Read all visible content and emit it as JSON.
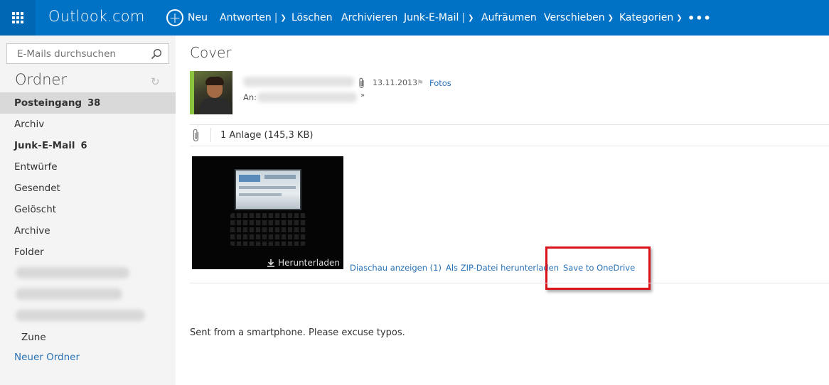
{
  "app": {
    "brand": "Outlook.com"
  },
  "toolbar": {
    "new_label": "Neu",
    "reply_label": "Antworten",
    "delete_label": "Löschen",
    "archive_label": "Archivieren",
    "junk_label": "Junk-E-Mail",
    "sweep_label": "Aufräumen",
    "move_label": "Verschieben",
    "categories_label": "Kategorien",
    "more_label": "•••"
  },
  "sidebar": {
    "search_placeholder": "E-Mails durchsuchen",
    "folders_title": "Ordner",
    "folders": [
      {
        "label": "Posteingang",
        "count": "38"
      },
      {
        "label": "Archiv",
        "count": ""
      },
      {
        "label": "Junk-E-Mail",
        "count": "6"
      },
      {
        "label": "Entwürfe",
        "count": ""
      },
      {
        "label": "Gesendet",
        "count": ""
      },
      {
        "label": "Gelöscht",
        "count": ""
      },
      {
        "label": "Archive",
        "count": ""
      },
      {
        "label": "Folder",
        "count": ""
      },
      {
        "label": "Zune",
        "count": ""
      }
    ],
    "new_folder_label": "Neuer Ordner"
  },
  "message": {
    "subject": "Cover",
    "date": "13.11.2013",
    "category_link": "Fotos",
    "to_label": "An:",
    "attachment_summary": "1 Anlage (145,3 KB)",
    "download_label": "Herunterladen",
    "slideshow_link": "Diaschau anzeigen (1)",
    "zip_link": "Als ZIP-Datei herunterladen",
    "onedrive_link": "Save to OneDrive",
    "body": "Sent from a smartphone. Please excuse typos."
  },
  "colors": {
    "header_blue": "#0072c6",
    "link_blue": "#2a72b5",
    "highlight_red": "#d9131a",
    "sidebar_bg": "#f4f4f4"
  }
}
